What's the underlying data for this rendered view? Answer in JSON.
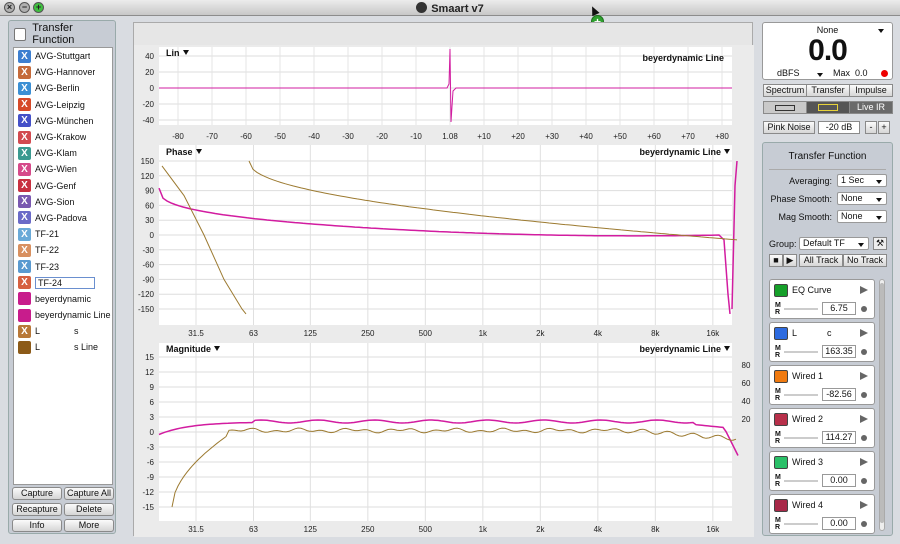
{
  "window": {
    "title": "Smaart v7"
  },
  "left_panel": {
    "header": "Transfer Function",
    "items": [
      {
        "label": "AVG-Stuttgart",
        "badge": "X",
        "color": "#3d7fd0"
      },
      {
        "label": "AVG-Hannover",
        "badge": "X",
        "color": "#c56a3a"
      },
      {
        "label": "AVG-Berlin",
        "badge": "X",
        "color": "#3b8fd4"
      },
      {
        "label": "AVG-Leipzig",
        "badge": "X",
        "color": "#d64a2a"
      },
      {
        "label": "AVG-München",
        "badge": "X",
        "color": "#4450c8"
      },
      {
        "label": "AVG-Krakow",
        "badge": "X",
        "color": "#d24a50"
      },
      {
        "label": "AVG-Klam",
        "badge": "X",
        "color": "#3b9a90"
      },
      {
        "label": "AVG-Wien",
        "badge": "X",
        "color": "#d64a8a"
      },
      {
        "label": "AVG-Genf",
        "badge": "X",
        "color": "#c83040"
      },
      {
        "label": "AVG-Sion",
        "badge": "X",
        "color": "#7a58b0"
      },
      {
        "label": "AVG-Padova",
        "badge": "X",
        "color": "#6a6ac8"
      },
      {
        "label": "TF-21",
        "badge": "X",
        "color": "#6aaad8"
      },
      {
        "label": "TF-22",
        "badge": "X",
        "color": "#d89060"
      },
      {
        "label": "TF-23",
        "badge": "X",
        "color": "#5a9ad0"
      },
      {
        "label": "TF-24",
        "badge": "X",
        "color": "#d66040"
      },
      {
        "label": "beyerdynamic",
        "badge": "",
        "color": "#c81c8c"
      },
      {
        "label": "beyerdynamic Line",
        "badge": "",
        "color": "#c81c8c"
      },
      {
        "label": "L",
        "suffix": "s",
        "badge": "X",
        "color": "#b87838"
      },
      {
        "label": "L",
        "suffix": "s Line",
        "badge": "",
        "color": "#8c5a18"
      }
    ],
    "buttons": [
      "Capture",
      "Capture All",
      "Recapture",
      "Delete",
      "Info",
      "More"
    ]
  },
  "plots": {
    "lin": {
      "title": "Lin",
      "trace_label": "beyerdynamic Line",
      "y_ticks": [
        "40",
        "20",
        "0",
        "-20",
        "-40"
      ],
      "x_ticks": [
        "-80",
        "-70",
        "-60",
        "-50",
        "-40",
        "-30",
        "-20",
        "-10",
        "1.08",
        "+10",
        "+20",
        "+30",
        "+40",
        "+50",
        "+60",
        "+70",
        "+80"
      ]
    },
    "phase": {
      "title": "Phase",
      "trace_label": "beyerdynamic Line",
      "y_ticks": [
        "150",
        "120",
        "90",
        "60",
        "30",
        "0",
        "-30",
        "-60",
        "-90",
        "-120",
        "-150"
      ]
    },
    "magnitude": {
      "title": "Magnitude",
      "trace_label": "beyerdynamic Line",
      "y_ticks": [
        "15",
        "12",
        "9",
        "6",
        "3",
        "0",
        "-3",
        "-6",
        "-9",
        "-12",
        "-15"
      ],
      "right_ticks": [
        "80",
        "60",
        "40",
        "20"
      ]
    },
    "freq_ticks": [
      "31.5",
      "63",
      "125",
      "250",
      "500",
      "1k",
      "2k",
      "4k",
      "8k",
      "16k"
    ]
  },
  "meter": {
    "source": "None",
    "value": "0.0",
    "unit": "dBFS",
    "max_label": "Max",
    "max_value": "0.0"
  },
  "tabs": [
    "Spectrum",
    "Transfer",
    "Impulse"
  ],
  "view_buttons": [
    "Live IR"
  ],
  "generator": {
    "label": "Pink Noise",
    "level": "-20 dB",
    "minus": "-",
    "plus": "+"
  },
  "tf_panel": {
    "title": "Transfer Function",
    "averaging": {
      "label": "Averaging:",
      "value": "1 Sec"
    },
    "phase_smooth": {
      "label": "Phase Smooth:",
      "value": "None"
    },
    "mag_smooth": {
      "label": "Mag Smooth:",
      "value": "None"
    },
    "group": {
      "label": "Group:",
      "value": "Default TF"
    },
    "all_track": "All Track",
    "no_track": "No Track",
    "channels": [
      {
        "name": "EQ Curve",
        "delay": "6.75",
        "color": "#16a02a"
      },
      {
        "name": "L",
        "name_suffix": "c",
        "delay": "163.35",
        "color": "#2d6be0"
      },
      {
        "name": "Wired 1",
        "delay": "-82.56",
        "color": "#f07a10"
      },
      {
        "name": "Wired 2",
        "delay": "114.27",
        "color": "#b8304a"
      },
      {
        "name": "Wired 3",
        "delay": "0.00",
        "color": "#2ac068"
      },
      {
        "name": "Wired 4",
        "delay": "0.00",
        "color": "#a82848"
      }
    ]
  },
  "mr_label": "M\nR",
  "colors": {
    "magenta": "#d21ca0",
    "brown": "#9c7a30"
  }
}
